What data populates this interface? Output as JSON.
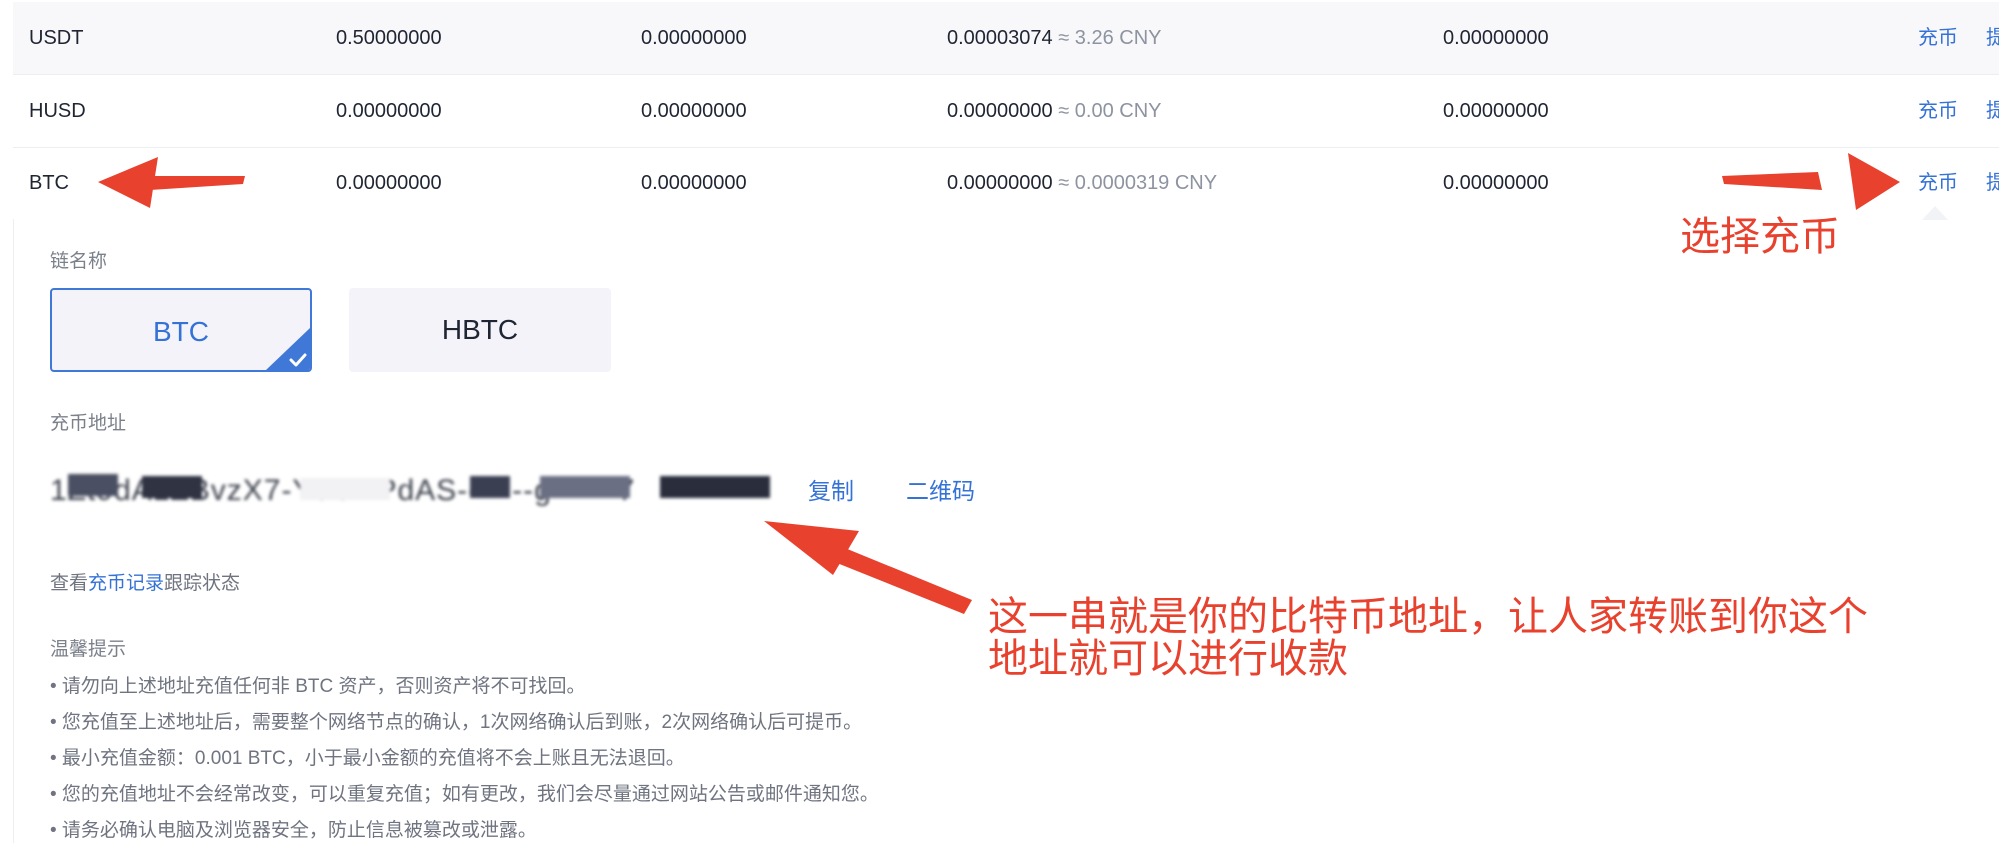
{
  "table": {
    "rows": [
      {
        "coin": "USDT",
        "col2": "0.50000000",
        "col3": "0.00000000",
        "value": "0.00003074",
        "approx": "≈ 3.26 CNY",
        "col5": "0.00000000",
        "deposit": "充币",
        "withdraw": "提"
      },
      {
        "coin": "HUSD",
        "col2": "0.00000000",
        "col3": "0.00000000",
        "value": "0.00000000",
        "approx": "≈ 0.00 CNY",
        "col5": "0.00000000",
        "deposit": "充币",
        "withdraw": "提"
      },
      {
        "coin": "BTC",
        "col2": "0.00000000",
        "col3": "0.00000000",
        "value": "0.00000000",
        "approx": "≈ 0.0000319 CNY",
        "col5": "0.00000000",
        "deposit": "充币",
        "withdraw": "提"
      }
    ]
  },
  "deposit_panel": {
    "chain_label": "链名称",
    "chains": [
      {
        "name": "BTC",
        "selected": true
      },
      {
        "name": "HBTC",
        "selected": false
      }
    ],
    "address_label": "充币地址",
    "address_redacted": "1Zt9dA1ZBvzX7-Y8CHPdAS-------g------7",
    "copy_label": "复制",
    "qr_label": "二维码",
    "record_prefix": "查看",
    "record_link": "充币记录",
    "record_suffix": "跟踪状态",
    "tips_title": "温馨提示",
    "tips": [
      "• 请勿向上述地址充值任何非 BTC 资产，否则资产将不可找回。",
      "• 您充值至上述地址后，需要整个网络节点的确认，1次网络确认后到账，2次网络确认后可提币。",
      "• 最小充值金额：0.001 BTC，小于最小金额的充值将不会上账且无法退回。",
      "• 您的充值地址不会经常改变，可以重复充值；如有更改，我们会尽量通过网站公告或邮件通知您。",
      "• 请务必确认电脑及浏览器安全，防止信息被篡改或泄露。"
    ]
  },
  "annotations": {
    "select_deposit": "选择充币",
    "address_note_line1": "这一串就是你的比特币地址，让人家转账到你这个",
    "address_note_line2": "地址就可以进行收款"
  },
  "colors": {
    "accent": "#3572d6",
    "annotation": "#e8412e",
    "stripe": "#f8f8fa"
  }
}
